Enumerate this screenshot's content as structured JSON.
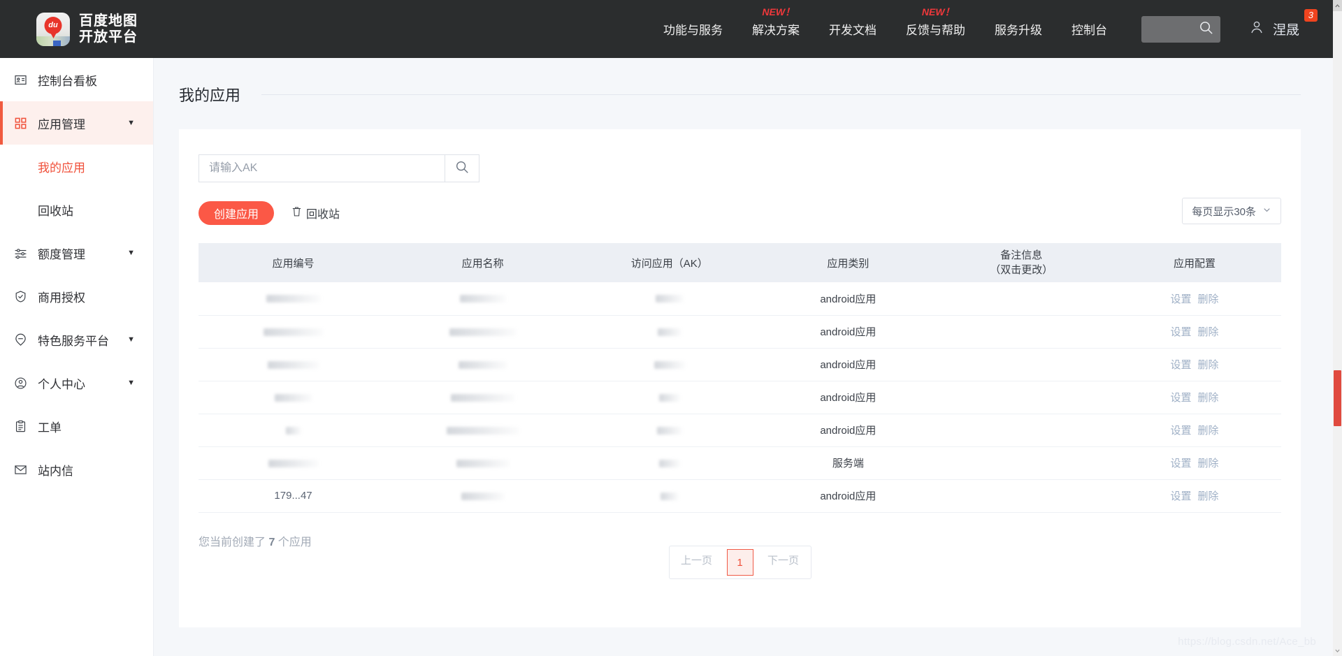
{
  "header": {
    "logo": {
      "line1": "百度地图",
      "line2": "开放平台",
      "pin_text": "du"
    },
    "nav": [
      {
        "label": "功能与服务",
        "new": ""
      },
      {
        "label": "解决方案",
        "new": "NEW！"
      },
      {
        "label": "开发文档",
        "new": ""
      },
      {
        "label": "反馈与帮助",
        "new": "NEW！"
      },
      {
        "label": "服务升级",
        "new": ""
      },
      {
        "label": "控制台",
        "new": ""
      }
    ],
    "user": {
      "name": "涅晟",
      "badge": "3"
    }
  },
  "sidebar": {
    "items": [
      {
        "label": "控制台看板",
        "icon": "id-card-icon",
        "expandable": false,
        "active": false
      },
      {
        "label": "应用管理",
        "icon": "grid-icon",
        "expandable": true,
        "active": true
      },
      {
        "label": "额度管理",
        "icon": "sliders-icon",
        "expandable": true,
        "active": false
      },
      {
        "label": "商用授权",
        "icon": "shield-check-icon",
        "expandable": false,
        "active": false
      },
      {
        "label": "特色服务平台",
        "icon": "tag-pin-icon",
        "expandable": true,
        "active": false
      },
      {
        "label": "个人中心",
        "icon": "user-circle-icon",
        "expandable": true,
        "active": false
      },
      {
        "label": "工单",
        "icon": "clipboard-icon",
        "expandable": false,
        "active": false
      },
      {
        "label": "站内信",
        "icon": "envelope-icon",
        "expandable": false,
        "active": false
      }
    ],
    "sub_items": [
      {
        "label": "我的应用",
        "active": true
      },
      {
        "label": "回收站",
        "active": false
      }
    ]
  },
  "main": {
    "page_title": "我的应用",
    "search": {
      "placeholder": "请输入AK",
      "value": ""
    },
    "buttons": {
      "create": "创建应用",
      "recycle": "回收站"
    },
    "per_page": "每页显示30条",
    "table": {
      "columns": [
        "应用编号",
        "应用名称",
        "访问应用（AK）",
        "应用类别",
        "备注信息",
        "（双击更改）",
        "应用配置"
      ],
      "headers": [
        {
          "label": "应用编号"
        },
        {
          "label": "应用名称"
        },
        {
          "label": "访问应用（AK）"
        },
        {
          "label": "应用类别"
        },
        {
          "label": "备注信息",
          "sub": "（双击更改）"
        },
        {
          "label": "应用配置"
        }
      ],
      "rows": [
        {
          "app_id": "",
          "app_name": "",
          "ak": "",
          "category": "android应用",
          "note": "",
          "actions": [
            "设置",
            "删除"
          ]
        },
        {
          "app_id": "",
          "app_name": "",
          "ak": "",
          "category": "android应用",
          "note": "",
          "actions": [
            "设置",
            "删除"
          ]
        },
        {
          "app_id": "",
          "app_name": "",
          "ak": "",
          "category": "android应用",
          "note": "",
          "actions": [
            "设置",
            "删除"
          ]
        },
        {
          "app_id": "",
          "app_name": "",
          "ak": "",
          "category": "android应用",
          "note": "",
          "actions": [
            "设置",
            "删除"
          ]
        },
        {
          "app_id": "",
          "app_name": "",
          "ak": "",
          "category": "android应用",
          "note": "",
          "actions": [
            "设置",
            "删除"
          ]
        },
        {
          "app_id": "",
          "app_name": "",
          "ak": "",
          "category": "服务端",
          "note": "",
          "actions": [
            "设置",
            "删除"
          ]
        },
        {
          "app_id": "179...47",
          "app_name": "",
          "ak": "",
          "category": "android应用",
          "note": "",
          "actions": [
            "设置",
            "删除"
          ]
        }
      ]
    },
    "summary": {
      "prefix": "您当前创建了 ",
      "count": "7",
      "suffix": " 个应用"
    },
    "pagination": {
      "prev": "上一页",
      "current": "1",
      "next": "下一页"
    }
  },
  "watermark": "https://blog.csdn.net/Ace_bb",
  "colors": {
    "accent": "#f0503a",
    "create_button": "#fb5846",
    "topbar": "#2b2d2e",
    "new_flag": "#f0383b"
  }
}
